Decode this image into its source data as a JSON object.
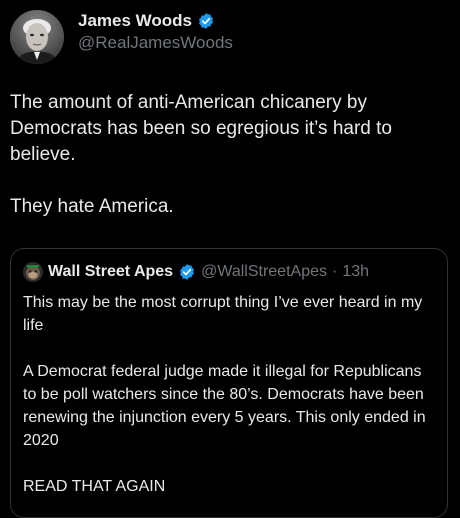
{
  "colors": {
    "background": "#000000",
    "primary_text": "#e7e9ea",
    "secondary_text": "#71767b",
    "verified_badge": "#1d9bf0",
    "card_border": "#2f3336"
  },
  "author": {
    "name": "James Woods",
    "handle": "@RealJamesWoods",
    "avatar_icon": "profile-photo",
    "verified_icon": "verified-badge-icon"
  },
  "tweet": {
    "paragraphs": [
      "The amount of anti-American chicanery by Democrats has been so egregious it’s hard to believe.",
      "They hate America."
    ]
  },
  "quote": {
    "name": "Wall Street Apes",
    "handle": "@WallStreetApes",
    "separator": "·",
    "time": "13h",
    "verified_icon": "verified-badge-icon",
    "paragraphs": [
      "This may be the most corrupt thing I’ve ever heard in my life",
      "A Democrat federal judge made it illegal for Republicans to be poll watchers since the 80’s. Democrats have been renewing the injunction every 5 years. This only ended in 2020",
      "READ THAT AGAIN"
    ]
  }
}
